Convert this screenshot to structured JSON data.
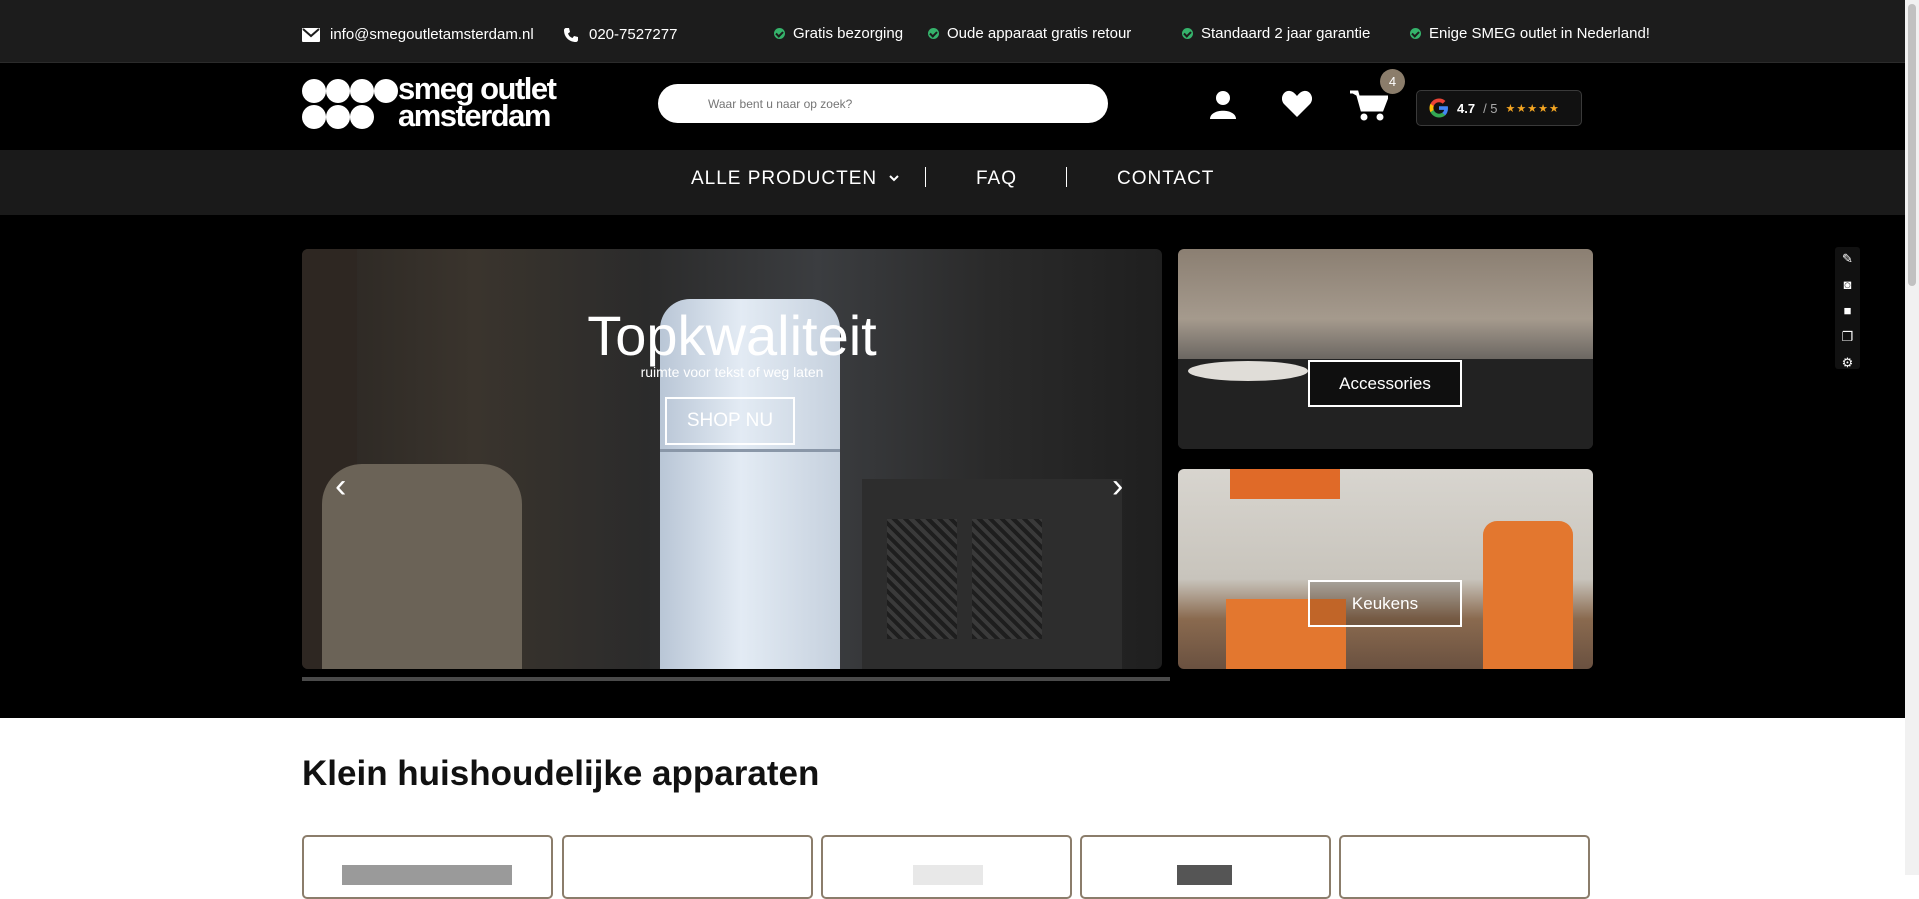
{
  "topbar": {
    "email": "info@smegoutletamsterdam.nl",
    "phone": "020-7527277",
    "usps": [
      "Gratis bezorging",
      "Oude apparaat gratis retour",
      "Standaard 2 jaar garantie",
      "Enige SMEG outlet in Nederland!"
    ]
  },
  "header": {
    "logo_line1": "smeg outlet",
    "logo_line2": "amsterdam",
    "search_placeholder": "Waar bent u naar op zoek?",
    "cart_count": "4",
    "rating_value": "4.7",
    "rating_scale": "/ 5",
    "rating_stars": "★★★★★"
  },
  "nav": {
    "items": [
      "ALLE PRODUCTEN",
      "FAQ",
      "CONTACT"
    ]
  },
  "hero": {
    "title": "Topkwaliteit",
    "subtitle": "ruimte voor tekst of weg laten",
    "button": "SHOP NU",
    "prev_icon": "‹",
    "next_icon": "›",
    "tiles": [
      "Accessories",
      "Keukens"
    ]
  },
  "section": {
    "title": "Klein huishoudelijke apparaten"
  },
  "colors": {
    "accent": "#8b7d6b",
    "check": "#35b36b",
    "star": "#f5a623"
  },
  "icons": {
    "email": "envelope-icon",
    "phone": "phone-icon",
    "account": "user-icon",
    "wishlist": "heart-icon",
    "cart": "cart-icon"
  }
}
